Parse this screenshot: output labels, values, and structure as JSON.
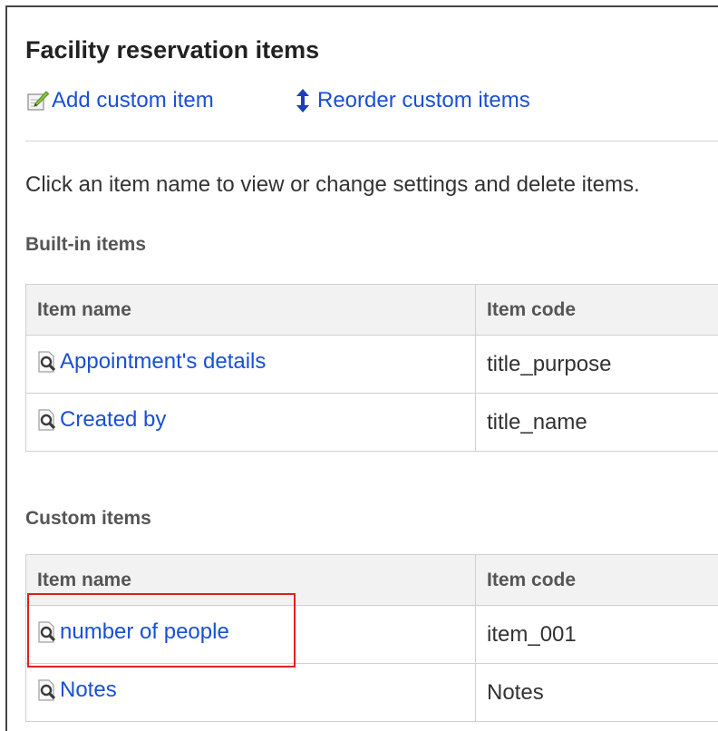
{
  "page": {
    "title": "Facility reservation items"
  },
  "toolbar": {
    "add_label": "Add custom item",
    "reorder_label": "Reorder custom items"
  },
  "description": "Click an item name to view or change settings and delete items.",
  "builtin": {
    "title": "Built-in items",
    "columns": [
      "Item name",
      "Item code"
    ],
    "rows": [
      {
        "name": "Appointment's details",
        "code": "title_purpose"
      },
      {
        "name": "Created by",
        "code": "title_name"
      }
    ]
  },
  "custom": {
    "title": "Custom items",
    "columns": [
      "Item name",
      "Item code"
    ],
    "rows": [
      {
        "name": "number of people",
        "code": "item_001"
      },
      {
        "name": "Notes",
        "code": "Notes"
      }
    ]
  },
  "icons": {
    "add": "pencil-edit-icon",
    "reorder": "up-down-arrow-icon",
    "item": "magnifier-document-icon"
  },
  "colors": {
    "link": "#1a4fd6",
    "highlight": "#e0211b",
    "header_bg": "#f2f2f2",
    "border": "#cfcfcf"
  }
}
